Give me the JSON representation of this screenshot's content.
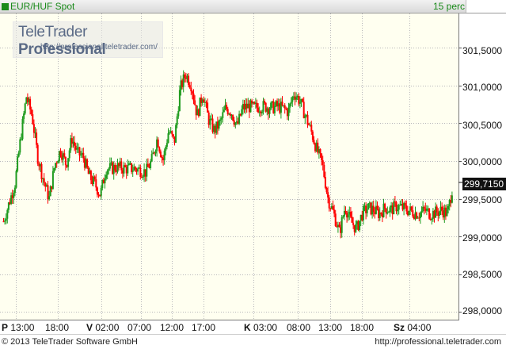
{
  "header": {
    "instrument": "EUR/HUF Spot",
    "interval": "15 perc"
  },
  "watermark": {
    "brand_plain": "TeleTrader ",
    "brand_bold": "Professional",
    "url": "http://professional.teletrader.com/"
  },
  "current_price": "299,7150",
  "footer": {
    "copyright": "© 2013 TeleTrader Software GmbH",
    "url": "http://professional.teletrader.com"
  },
  "colors": {
    "up": "#1e9b1e",
    "down": "#ff0000",
    "grid": "#b8b8b8",
    "background": "#fffff0"
  },
  "chart_data": {
    "type": "candlestick",
    "ylim": [
      297.9,
      301.95
    ],
    "y_ticks": [
      "301,5000",
      "301,0000",
      "300,5000",
      "300,0000",
      "299,5000",
      "299,0000",
      "298,5000",
      "298,0000"
    ],
    "y_tick_values": [
      301.5,
      301.0,
      300.5,
      300.0,
      299.5,
      299.0,
      298.5,
      298.0
    ],
    "x_ticks": [
      {
        "day": "P",
        "time": "13:00"
      },
      {
        "day": "",
        "time": "18:00"
      },
      {
        "day": "V",
        "time": "02:00"
      },
      {
        "day": "",
        "time": "07:00"
      },
      {
        "day": "",
        "time": "12:00"
      },
      {
        "day": "",
        "time": "17:00"
      },
      {
        "day": "K",
        "time": "03:00"
      },
      {
        "day": "",
        "time": "08:00"
      },
      {
        "day": "",
        "time": "13:00"
      },
      {
        "day": "",
        "time": "18:00"
      },
      {
        "day": "Sz",
        "time": "04:00"
      }
    ],
    "closes": [
      299.2,
      299.45,
      299.7,
      300.3,
      300.85,
      300.6,
      300.05,
      299.75,
      299.5,
      299.95,
      300.15,
      299.95,
      300.3,
      300.1,
      300.05,
      299.8,
      299.7,
      299.55,
      299.9,
      299.9,
      299.92,
      299.9,
      299.9,
      299.9,
      299.88,
      299.85,
      300.0,
      300.3,
      300.0,
      300.4,
      300.25,
      300.95,
      301.15,
      301.0,
      300.6,
      300.9,
      300.55,
      300.4,
      300.5,
      300.7,
      300.65,
      300.45,
      300.7,
      300.72,
      300.7,
      300.72,
      300.72,
      300.7,
      300.72,
      300.7,
      300.65,
      300.9,
      300.8,
      300.6,
      300.4,
      300.15,
      299.95,
      299.5,
      299.3,
      299.05,
      299.4,
      299.2,
      299.1,
      299.3,
      299.38,
      299.35,
      299.3,
      299.38,
      299.35,
      299.4,
      299.38,
      299.35,
      299.32,
      299.3,
      299.35,
      299.3,
      299.32,
      299.35,
      299.3,
      299.72
    ]
  }
}
